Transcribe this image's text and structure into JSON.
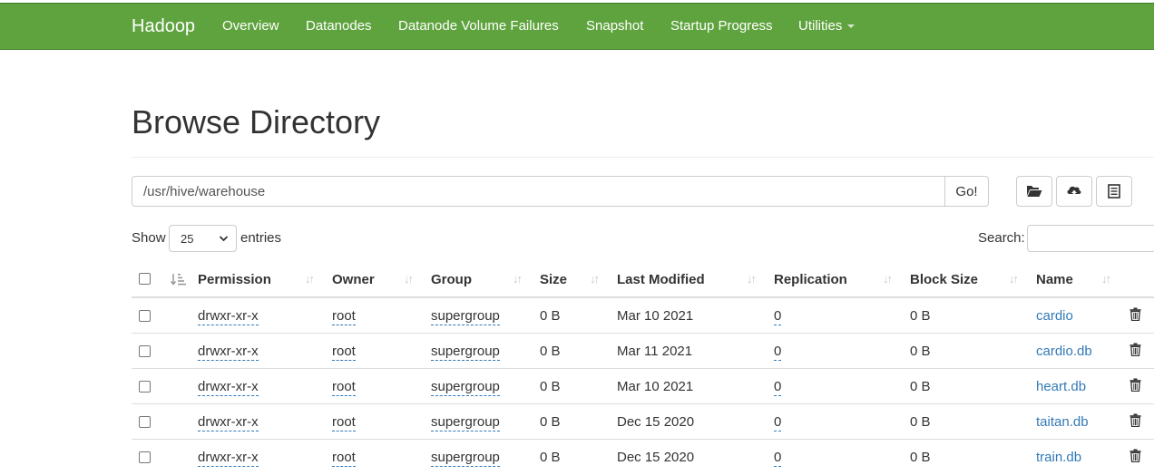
{
  "navbar": {
    "brand": "Hadoop",
    "items": [
      "Overview",
      "Datanodes",
      "Datanode Volume Failures",
      "Snapshot",
      "Startup Progress",
      "Utilities"
    ]
  },
  "page": {
    "title": "Browse Directory"
  },
  "pathbar": {
    "value": "/usr/hive/warehouse",
    "go_label": "Go!"
  },
  "toolbar": {
    "icons": [
      "folder-open-icon",
      "upload-icon",
      "list-icon"
    ]
  },
  "table_controls": {
    "show_label": "Show",
    "entries_value": "25",
    "entries_label": "entries",
    "search_label": "Search:"
  },
  "table": {
    "headers": [
      "Permission",
      "Owner",
      "Group",
      "Size",
      "Last Modified",
      "Replication",
      "Block Size",
      "Name"
    ],
    "rows": [
      {
        "permission": "drwxr-xr-x",
        "owner": "root",
        "group": "supergroup",
        "size": "0 B",
        "modified": "Mar 10 2021",
        "replication": "0",
        "block_size": "0 B",
        "name": "cardio"
      },
      {
        "permission": "drwxr-xr-x",
        "owner": "root",
        "group": "supergroup",
        "size": "0 B",
        "modified": "Mar 11 2021",
        "replication": "0",
        "block_size": "0 B",
        "name": "cardio.db"
      },
      {
        "permission": "drwxr-xr-x",
        "owner": "root",
        "group": "supergroup",
        "size": "0 B",
        "modified": "Mar 10 2021",
        "replication": "0",
        "block_size": "0 B",
        "name": "heart.db"
      },
      {
        "permission": "drwxr-xr-x",
        "owner": "root",
        "group": "supergroup",
        "size": "0 B",
        "modified": "Dec 15 2020",
        "replication": "0",
        "block_size": "0 B",
        "name": "taitan.db"
      },
      {
        "permission": "drwxr-xr-x",
        "owner": "root",
        "group": "supergroup",
        "size": "0 B",
        "modified": "Dec 15 2020",
        "replication": "0",
        "block_size": "0 B",
        "name": "train.db"
      }
    ]
  },
  "colors": {
    "navbar": "#5fa33e",
    "link": "#337ab7",
    "text": "#333333",
    "border": "#dddddd"
  }
}
